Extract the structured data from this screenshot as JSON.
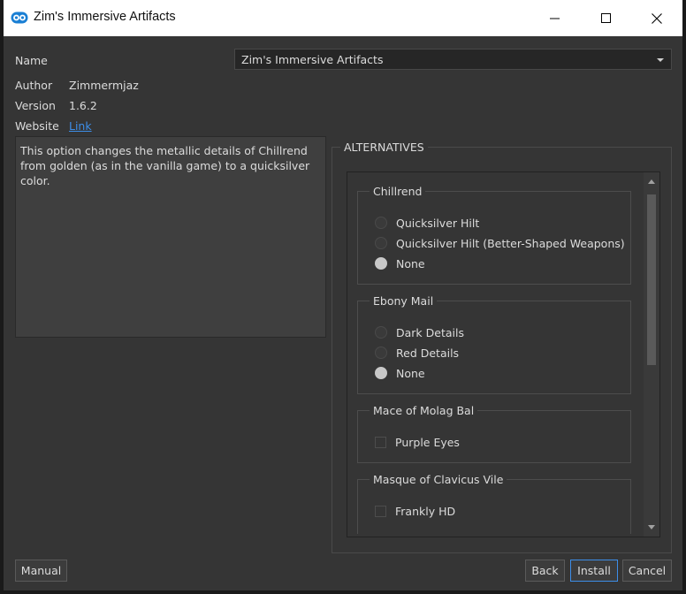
{
  "window": {
    "title": "Zim's Immersive Artifacts"
  },
  "info": {
    "name_label": "Name",
    "name_value": "Zim's Immersive Artifacts",
    "author_label": "Author",
    "author_value": "Zimmermjaz",
    "version_label": "Version",
    "version_value": "1.6.2",
    "website_label": "Website",
    "website_link": "Link"
  },
  "description": "This option changes the metallic details of Chillrend from golden (as in the vanilla game) to a quicksilver color.",
  "alternatives": {
    "title": "ALTERNATIVES",
    "groups": [
      {
        "title": "Chillrend",
        "type": "radio",
        "options": [
          {
            "label": "Quicksilver Hilt",
            "checked": false
          },
          {
            "label": "Quicksilver Hilt (Better-Shaped Weapons)",
            "checked": false
          },
          {
            "label": "None",
            "checked": true
          }
        ]
      },
      {
        "title": "Ebony Mail",
        "type": "radio",
        "options": [
          {
            "label": "Dark Details",
            "checked": false
          },
          {
            "label": "Red Details",
            "checked": false
          },
          {
            "label": "None",
            "checked": true
          }
        ]
      },
      {
        "title": "Mace of Molag Bal",
        "type": "checkbox",
        "options": [
          {
            "label": "Purple Eyes",
            "checked": false
          }
        ]
      },
      {
        "title": "Masque of Clavicus Vile",
        "type": "checkbox",
        "options": [
          {
            "label": "Frankly HD",
            "checked": false
          }
        ]
      }
    ]
  },
  "buttons": {
    "manual": "Manual",
    "back": "Back",
    "install": "Install",
    "cancel": "Cancel"
  },
  "colors": {
    "background": "#353535",
    "link": "#3d8ee8",
    "focus_border": "#3d8ee8"
  }
}
